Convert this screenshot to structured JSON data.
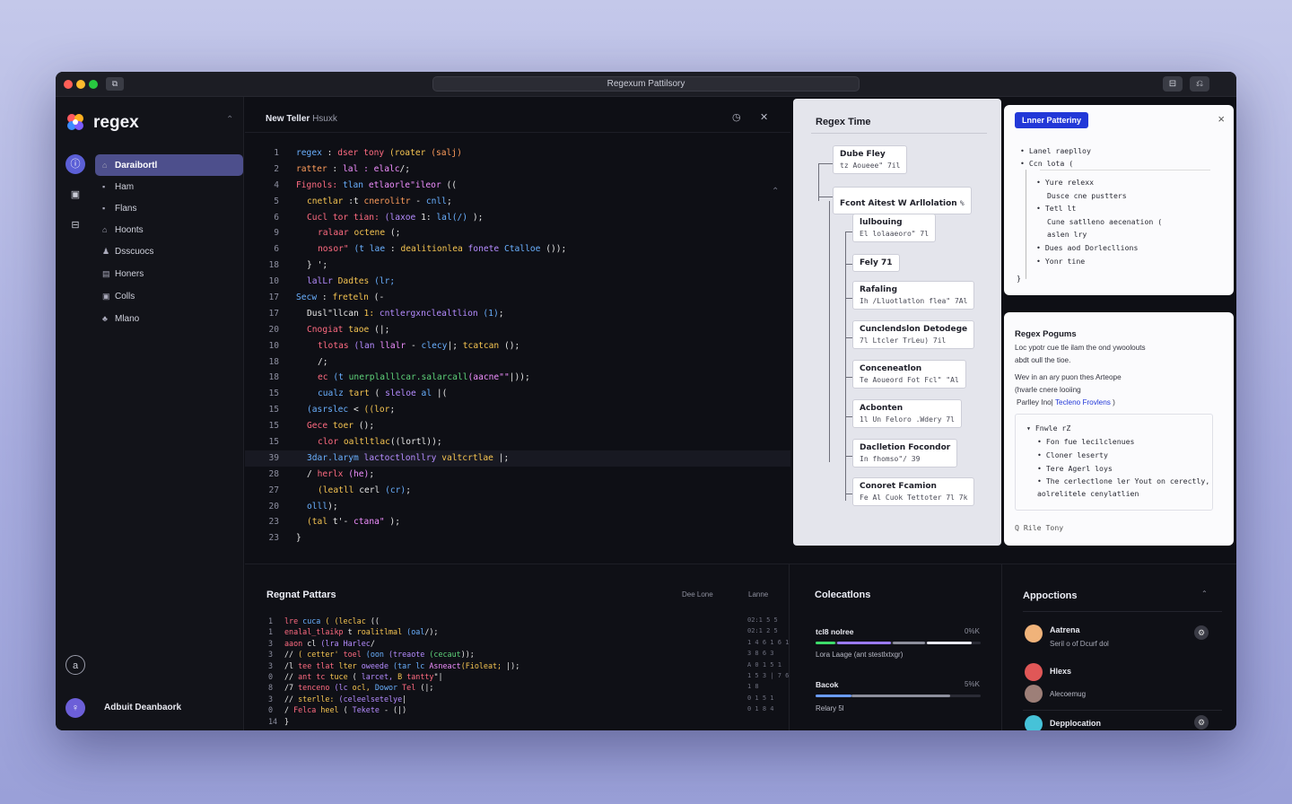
{
  "window": {
    "url": "Regexum Pattilsory",
    "left_icon": "⧉",
    "right_icons": [
      "⊟",
      "⎌"
    ]
  },
  "sidebar": {
    "brand": "regex",
    "items": [
      {
        "icon": "⌂",
        "label": "Daraibortl",
        "active": true
      },
      {
        "icon": "▪",
        "label": "Ham"
      },
      {
        "icon": "▪",
        "label": "Flans"
      },
      {
        "icon": "⌂",
        "label": "Hoonts"
      },
      {
        "icon": "♟",
        "label": "Dsscuocs"
      },
      {
        "icon": "▤",
        "label": "Honers"
      },
      {
        "icon": "▣",
        "label": "Colls"
      },
      {
        "icon": "♣",
        "label": "Mlano"
      }
    ],
    "user": "Adbuit Deanbaork",
    "user_initial": "♀"
  },
  "editor": {
    "title": "New Teller",
    "subtitle": "Hsuxk",
    "lines": [
      {
        "n": "1",
        "indent": 0,
        "segs": [
          [
            "regex",
            "#6ab0ff"
          ],
          [
            " : ",
            "#e6e6e6"
          ],
          [
            "dser tony",
            "#ff6b81"
          ],
          [
            " (roater ",
            "#f5c451"
          ],
          [
            "(salj)",
            "#ff9d5c"
          ]
        ]
      },
      {
        "n": "2",
        "indent": 0,
        "segs": [
          [
            "ratter",
            "#ff9d5c"
          ],
          [
            " : ",
            "#e6e6e6"
          ],
          [
            "lal : elalc",
            "#f08fff"
          ],
          [
            "/;",
            "#e6e6e6"
          ]
        ]
      },
      {
        "n": "4",
        "indent": 0,
        "segs": [
          [
            "Fignols: ",
            "#ff6b81"
          ],
          [
            "tlan ",
            "#6ab0ff"
          ],
          [
            "etlaorle\"ileor",
            "#f08fff"
          ],
          [
            " ((",
            "#e6e6e6"
          ]
        ]
      },
      {
        "n": "5",
        "indent": 1,
        "segs": [
          [
            "cnetlar ",
            "#f5c451"
          ],
          [
            ":t ",
            "#e6e6e6"
          ],
          [
            "cnerolitr",
            "#ff9d5c"
          ],
          [
            " - ",
            "#e6e6e6"
          ],
          [
            "cnll",
            "#6ab0ff"
          ],
          [
            ";",
            "#e6e6e6"
          ]
        ]
      },
      {
        "n": "6",
        "indent": 1,
        "segs": [
          [
            "Cucl tor tian: ",
            "#ff6b81"
          ],
          [
            "(laxoe ",
            "#b58cff"
          ],
          [
            "1: ",
            "#e6e6e6"
          ],
          [
            "lal(/) ",
            "#6ab0ff"
          ],
          [
            ");",
            "#e6e6e6"
          ]
        ]
      },
      {
        "n": "9",
        "indent": 2,
        "segs": [
          [
            "ralaar ",
            "#ff6b81"
          ],
          [
            "octene ",
            "#f5c451"
          ],
          [
            "(;",
            "#e6e6e6"
          ]
        ]
      },
      {
        "n": "6",
        "indent": 2,
        "segs": [
          [
            "nosor\" ",
            "#ff6b81"
          ],
          [
            "(t lae ",
            "#6ab0ff"
          ],
          [
            ": ",
            "#e6e6e6"
          ],
          [
            "dealitionlea ",
            "#f5c451"
          ],
          [
            "fonete ",
            "#b58cff"
          ],
          [
            "Ctalloe ",
            "#6ab0ff"
          ],
          [
            "());",
            "#e6e6e6"
          ]
        ]
      },
      {
        "n": "18",
        "indent": 1,
        "segs": [
          [
            "} ",
            "#e6e6e6"
          ],
          [
            "';",
            "#e6e6e6"
          ]
        ]
      },
      {
        "n": "10",
        "indent": 1,
        "segs": [
          [
            "lalLr ",
            "#b58cff"
          ],
          [
            "Dadtes ",
            "#f5c451"
          ],
          [
            "(lr;",
            "#6ab0ff"
          ]
        ]
      },
      {
        "n": "17",
        "indent": 0,
        "segs": [
          [
            "Secw ",
            "#6ab0ff"
          ],
          [
            ": ",
            "#e6e6e6"
          ],
          [
            "freteln ",
            "#f5c451"
          ],
          [
            "(-",
            "#e6e6e6"
          ]
        ]
      },
      {
        "n": "17",
        "indent": 1,
        "segs": [
          [
            "Dusl\"llcan ",
            "#e6e6e6"
          ],
          [
            "1: ",
            "#f5c451"
          ],
          [
            "cntlergxnclealtlion ",
            "#b58cff"
          ],
          [
            "(1)",
            "#6ab0ff"
          ],
          [
            ";",
            "#e6e6e6"
          ]
        ]
      },
      {
        "n": "20",
        "indent": 1,
        "segs": [
          [
            "Cnogiat ",
            "#ff6b81"
          ],
          [
            "taoe ",
            "#f5c451"
          ],
          [
            "(|;",
            "#e6e6e6"
          ]
        ]
      },
      {
        "n": "10",
        "indent": 2,
        "segs": [
          [
            "tlotas ",
            "#ff6b81"
          ],
          [
            "(lan ",
            "#b58cff"
          ],
          [
            "llalr ",
            "#f08fff"
          ],
          [
            "- ",
            "#e6e6e6"
          ],
          [
            "clecy",
            "#6ab0ff"
          ],
          [
            "|; ",
            "#e6e6e6"
          ],
          [
            "tcatcan",
            "#f5c451"
          ],
          [
            " ();",
            "#e6e6e6"
          ]
        ]
      },
      {
        "n": "18",
        "indent": 2,
        "segs": [
          [
            "/;",
            "#e6e6e6"
          ]
        ]
      },
      {
        "n": "18",
        "indent": 2,
        "segs": [
          [
            "ec ",
            "#ff6b81"
          ],
          [
            "(t ",
            "#6ab0ff"
          ],
          [
            "unerplalllcar.salarcall",
            "#5fd37a"
          ],
          [
            "(aacne\"\"",
            "#f08fff"
          ],
          [
            "|));",
            "#e6e6e6"
          ]
        ]
      },
      {
        "n": "15",
        "indent": 2,
        "segs": [
          [
            "cualz ",
            "#6ab0ff"
          ],
          [
            "tart ",
            "#f5c451"
          ],
          [
            "( ",
            "#e6e6e6"
          ],
          [
            "sleloe ",
            "#b58cff"
          ],
          [
            "al ",
            "#6ab0ff"
          ],
          [
            "|(",
            "#e6e6e6"
          ]
        ]
      },
      {
        "n": "15",
        "indent": 1,
        "segs": [
          [
            "(asrslec ",
            "#6ab0ff"
          ],
          [
            "< ",
            "#e6e6e6"
          ],
          [
            "((lor",
            "#f5c451"
          ],
          [
            ";",
            "#e6e6e6"
          ]
        ]
      },
      {
        "n": "15",
        "indent": 1,
        "segs": [
          [
            "Gece ",
            "#ff6b81"
          ],
          [
            "toer ",
            "#f5c451"
          ],
          [
            "();",
            "#e6e6e6"
          ]
        ]
      },
      {
        "n": "15",
        "indent": 2,
        "segs": [
          [
            "clor ",
            "#ff6b81"
          ],
          [
            "oaltltlac",
            "#f5c451"
          ],
          [
            "((lortl)",
            "#e6e6e6"
          ],
          [
            ");",
            "#e6e6e6"
          ]
        ]
      },
      {
        "n": "39",
        "indent": 1,
        "hl": true,
        "segs": [
          [
            "3dar.larym ",
            "#6ab0ff"
          ],
          [
            "lactoctlonllry ",
            "#b58cff"
          ],
          [
            "valtcrtlae ",
            "#f5c451"
          ],
          [
            "|;",
            "#e6e6e6"
          ]
        ]
      },
      {
        "n": "28",
        "indent": 1,
        "segs": [
          [
            "/ ",
            "#e6e6e6"
          ],
          [
            "herlx ",
            "#ff6b81"
          ],
          [
            "(he)",
            "#f08fff"
          ],
          [
            ";",
            "#e6e6e6"
          ]
        ]
      },
      {
        "n": "27",
        "indent": 2,
        "segs": [
          [
            "(leatll ",
            "#f5c451"
          ],
          [
            "cerl ",
            "#e6e6e6"
          ],
          [
            "(cr)",
            "#6ab0ff"
          ],
          [
            ";",
            "#e6e6e6"
          ]
        ]
      },
      {
        "n": "20",
        "indent": 1,
        "segs": [
          [
            "olll",
            "#6ab0ff"
          ],
          [
            ");",
            "#e6e6e6"
          ]
        ]
      },
      {
        "n": "23",
        "indent": 1,
        "segs": [
          [
            "(tal ",
            "#f5c451"
          ],
          [
            "t'- ",
            "#e6e6e6"
          ],
          [
            "ctana\"",
            "#f08fff"
          ],
          [
            " );",
            "#e6e6e6"
          ]
        ]
      },
      {
        "n": "23",
        "indent": 0,
        "segs": [
          [
            "}",
            "#e6e6e6"
          ]
        ]
      }
    ]
  },
  "diagram": {
    "title": "Regex Time",
    "nodes": [
      {
        "title": "Dube Fley",
        "sub": "tz Aoueee\" 7il"
      },
      {
        "title": "Fcont Aitest W Arllolation ",
        "sub": "",
        "suffix": "%"
      },
      {
        "title": "lulbouing",
        "sub": "El lolaaeoro\" 7l"
      },
      {
        "title": "Fely 71",
        "sub": ""
      },
      {
        "title": "Rafaling",
        "sub": "Ih /Lluotlatlon flea\"   7Al"
      },
      {
        "title": "Cunclendslon Detodege",
        "sub": "7l Ltcler TrLeu)    7il"
      },
      {
        "title": "Conceneatlon",
        "sub": "Te Aoueord Fot Fcl\"  \"Al"
      },
      {
        "title": "Acbonten",
        "sub": "1l Un Feloro .Wdery    7l"
      },
      {
        "title": "Daclletion Focondor",
        "sub": "In fhomso\"/         39"
      },
      {
        "title": "Conoret Fcamion",
        "sub": "Fe Al Cuok Tettoter 7l  7k"
      }
    ]
  },
  "linter": {
    "badge": "Lnner Patteriny",
    "close": "×",
    "lines": [
      "• Lanel raeplloy",
      "• Ccn lota (",
      "• Yure relexx",
      "Dusce cne pustters",
      "• Tetl lt",
      "Cune satlleno aecenation (",
      "aslen lry",
      "• Dues aod Dorlecllions",
      "• Yonr tine",
      "}"
    ]
  },
  "help": {
    "title": "Regex Pogums",
    "p1": "Loc ypotr cue tle ilam the ond ywoolouts",
    "p2": "abdt oull the tioe.",
    "p3": "Wev in an ary puon thes Arteope",
    "p4": "(hvarle cnere looiing",
    "p5": "Parlley Ino|",
    "link": "Tecleno Frovlens",
    "p5b": ")",
    "tree": [
      "▾ Fnwle rZ",
      "• Fon fue lecilclenues",
      "• Cloner leserty",
      "• Tere Agerl loys",
      "• The cerlectlone ler Yout on cerectly,",
      "aolrelitele cenylatlien"
    ],
    "footer": "Q  Rile Tony"
  },
  "bottom": {
    "regex_title": "Regnat Pattars",
    "regex_col1": "Dee Lone",
    "regex_col2": "Lanne",
    "regex_lines": [
      {
        "n": "1",
        "segs": [
          [
            "lre ",
            "#ff6b81"
          ],
          [
            "cuca ",
            "#6ab0ff"
          ],
          [
            "( (leclac ",
            "#f5c451"
          ],
          [
            "((",
            "#e6e6e6"
          ]
        ],
        "meta": "02:1 5 5"
      },
      {
        "n": "1",
        "segs": [
          [
            "   enalal_tlaikp ",
            "#ff6b81"
          ],
          [
            "t ",
            "#e6e6e6"
          ],
          [
            "roalitlmal ",
            "#f5c451"
          ],
          [
            "(oal",
            "#6ab0ff"
          ],
          [
            "/);",
            "#e6e6e6"
          ]
        ],
        "meta": "02:1 2 5"
      },
      {
        "n": "3",
        "segs": [
          [
            "   aaon ",
            "#ff6b81"
          ],
          [
            "cl ",
            "#e6e6e6"
          ],
          [
            "(lra Harlec",
            "#b58cff"
          ],
          [
            "/",
            "#e6e6e6"
          ]
        ],
        "meta": "1 4 6 1 6 1"
      },
      {
        "n": "3",
        "segs": [
          [
            "    // ",
            "#e6e6e6"
          ],
          [
            "( cetter' ",
            "#f5c451"
          ],
          [
            "toel ",
            "#ff6b81"
          ],
          [
            "(oon ",
            "#6ab0ff"
          ],
          [
            "(treaote ",
            "#b58cff"
          ],
          [
            "(cecaut",
            "#5fd37a"
          ],
          [
            "));",
            "#e6e6e6"
          ]
        ],
        "meta": "3 8 6 3"
      },
      {
        "n": "3",
        "segs": [
          [
            "    /l ",
            "#e6e6e6"
          ],
          [
            "tee tlat ",
            "#ff6b81"
          ],
          [
            "lter ",
            "#f5c451"
          ],
          [
            "oweede ",
            "#b58cff"
          ],
          [
            "(tar lc ",
            "#6ab0ff"
          ],
          [
            "Asneact",
            "#f08fff"
          ],
          [
            "(Fioleat; ",
            "#f5c451"
          ],
          [
            "|);",
            "#e6e6e6"
          ]
        ],
        "meta": "A 0  1 5 1"
      },
      {
        "n": "0",
        "segs": [
          [
            "    // ",
            "#e6e6e6"
          ],
          [
            "ant tc ",
            "#ff6b81"
          ],
          [
            "tuce ",
            "#f5c451"
          ],
          [
            "( ",
            "#e6e6e6"
          ],
          [
            "larcet, ",
            "#b58cff"
          ],
          [
            "B ",
            "#f5c451"
          ],
          [
            "tantty",
            "#ff6b81"
          ],
          [
            "\"|",
            "#e6e6e6"
          ]
        ],
        "meta": "1 5 3 | 7 6"
      },
      {
        "n": "8",
        "segs": [
          [
            "    /7 ",
            "#e6e6e6"
          ],
          [
            "tenceno ",
            "#ff6b81"
          ],
          [
            "(lc ",
            "#b58cff"
          ],
          [
            "ocl, ",
            "#f5c451"
          ],
          [
            "Dowor ",
            "#6ab0ff"
          ],
          [
            "Tel ",
            "#ff6b81"
          ],
          [
            "(|;",
            "#e6e6e6"
          ]
        ],
        "meta": "1 8"
      },
      {
        "n": "3",
        "segs": [
          [
            "    // ",
            "#e6e6e6"
          ],
          [
            "sterlle: ",
            "#f5c451"
          ],
          [
            "(celeelsetelye",
            "#b58cff"
          ],
          [
            "|",
            "#e6e6e6"
          ]
        ],
        "meta": "0 1 5 1"
      },
      {
        "n": "0",
        "segs": [
          [
            "    /   ",
            "#e6e6e6"
          ],
          [
            "Felca ",
            "#ff6b81"
          ],
          [
            "heel ",
            "#f5c451"
          ],
          [
            "( ",
            "#e6e6e6"
          ],
          [
            "Tekete ",
            "#b58cff"
          ],
          [
            "- (|)",
            "#e6e6e6"
          ]
        ],
        "meta": "0 1 8 4"
      },
      {
        "n": "14",
        "segs": [
          [
            "   }",
            "#e6e6e6"
          ]
        ],
        "meta": ""
      }
    ],
    "colors_title": "Colecatlons",
    "c1_label": "tcl8 nolree",
    "c1_meta": "0%K",
    "c1_text": "Lora Laage (ant stestlxtxgr)",
    "c2_label": "Bacok",
    "c2_meta": "5%K",
    "c2_text": "Relary 5l",
    "apps_title": "Appoctions",
    "people": [
      {
        "name": "Aatrena",
        "sub": "Seril o of Dcurf dol"
      },
      {
        "name": "Hlexs",
        "sub": ""
      },
      {
        "name": "Alecoemug",
        "sub": ""
      },
      {
        "name": "Depplocation",
        "sub": ""
      }
    ]
  },
  "colors": {
    "accent": "#4d4f8c",
    "link": "#2238d8"
  }
}
